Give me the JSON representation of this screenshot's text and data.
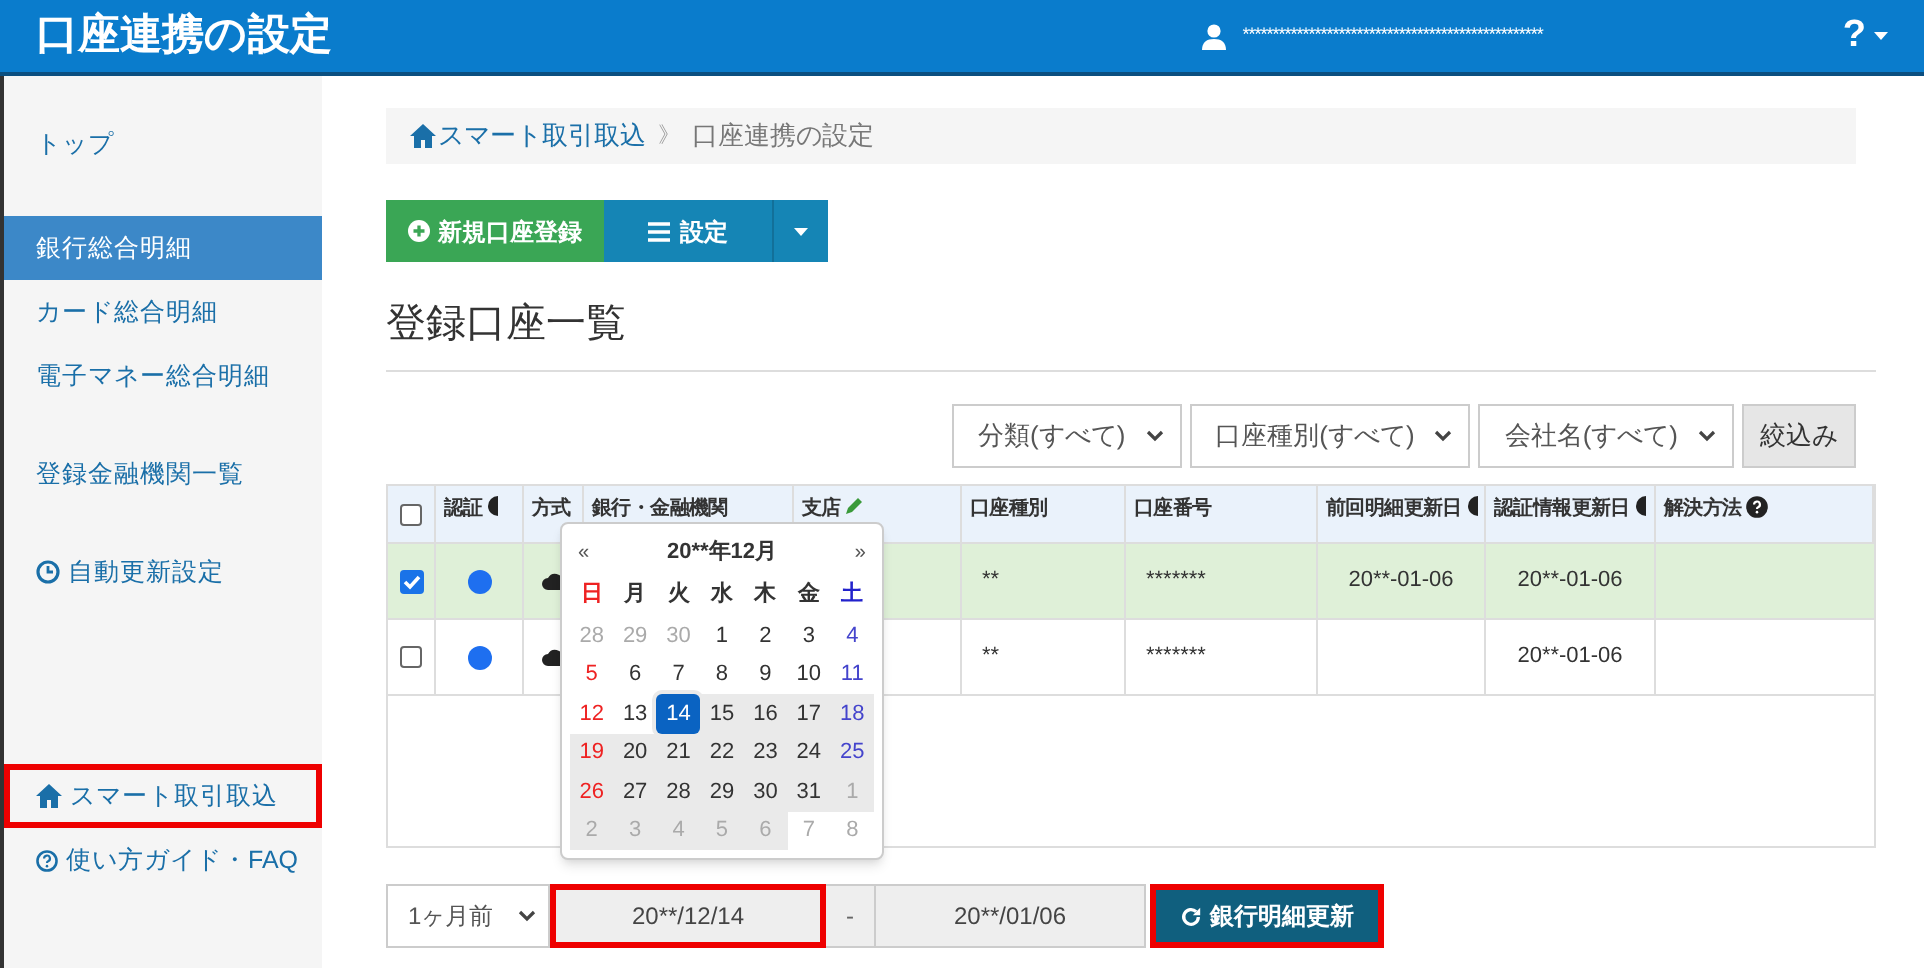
{
  "header": {
    "title": "口座連携の設定",
    "user": "**************************************************",
    "help": "?"
  },
  "sidebar": {
    "groups": [
      [
        {
          "label": "トップ",
          "selected": false,
          "highlighted": false
        }
      ],
      [
        {
          "label": "銀行総合明細",
          "selected": true,
          "highlighted": false
        },
        {
          "label": "カード総合明細",
          "selected": false,
          "highlighted": false
        },
        {
          "label": "電子マネー総合明細",
          "selected": false,
          "highlighted": false
        }
      ],
      [
        {
          "label": "登録金融機関一覧",
          "selected": false,
          "highlighted": false
        }
      ],
      [
        {
          "label": "自動更新設定",
          "kind": "clock",
          "selected": false,
          "highlighted": false
        }
      ],
      [
        {
          "label": "スマート取引取込",
          "kind": "home",
          "selected": false,
          "highlighted": true
        },
        {
          "label": "使い方ガイド・FAQ",
          "kind": "help",
          "selected": false,
          "highlighted": false
        }
      ]
    ]
  },
  "breadcrumb": [
    {
      "label": "スマート取引取込",
      "kind": "link"
    },
    {
      "label": "》",
      "kind": "separator"
    },
    {
      "label": "口座連携の設定",
      "kind": "current"
    }
  ],
  "actions": {
    "new_account": "新規口座登録",
    "settings": "設定"
  },
  "heading": "登録口座一覧",
  "filters": {
    "selects": [
      "分類(すべて)",
      "口座種別(すべて)",
      "会社名(すべて)"
    ],
    "button": "絞込み"
  },
  "table": {
    "select_all": {
      "checked": false
    },
    "columns": [
      {
        "label": "認証"
      },
      {
        "label": "方式"
      },
      {
        "label": "銀行・金融機関"
      },
      {
        "label": "支店"
      },
      {
        "label": "口座種別"
      },
      {
        "label": "口座番号"
      },
      {
        "label": "前回明細更新日"
      },
      {
        "label": "認証情報更新日"
      },
      {
        "label": "解決方法"
      }
    ],
    "rows": [
      {
        "checked": true,
        "account_type": "**",
        "account_number": "*******",
        "last_update": "20**-01-06",
        "auth_update": "20**-01-06"
      },
      {
        "checked": false,
        "account_type": "**",
        "account_number": "*******",
        "last_update": "",
        "auth_update": "20**-01-06"
      }
    ]
  },
  "calendar": {
    "prev": "«",
    "title": "20**年12月",
    "next": "»",
    "weekdays": [
      "日",
      "月",
      "火",
      "水",
      "木",
      "金",
      "土"
    ],
    "weeks": [
      [
        {
          "day": "28",
          "muted": true,
          "in_range": false,
          "selected": false
        },
        {
          "day": "29",
          "muted": true,
          "in_range": false,
          "selected": false
        },
        {
          "day": "30",
          "muted": true,
          "in_range": false,
          "selected": false
        },
        {
          "day": "1",
          "muted": false,
          "in_range": false,
          "selected": false
        },
        {
          "day": "2",
          "muted": false,
          "in_range": false,
          "selected": false
        },
        {
          "day": "3",
          "muted": false,
          "in_range": false,
          "selected": false
        },
        {
          "day": "4",
          "muted": false,
          "in_range": false,
          "selected": false
        }
      ],
      [
        {
          "day": "5",
          "muted": false,
          "in_range": false,
          "selected": false
        },
        {
          "day": "6",
          "muted": false,
          "in_range": false,
          "selected": false
        },
        {
          "day": "7",
          "muted": false,
          "in_range": false,
          "selected": false
        },
        {
          "day": "8",
          "muted": false,
          "in_range": false,
          "selected": false
        },
        {
          "day": "9",
          "muted": false,
          "in_range": false,
          "selected": false
        },
        {
          "day": "10",
          "muted": false,
          "in_range": false,
          "selected": false
        },
        {
          "day": "11",
          "muted": false,
          "in_range": false,
          "selected": false
        }
      ],
      [
        {
          "day": "12",
          "muted": false,
          "in_range": false,
          "selected": false
        },
        {
          "day": "13",
          "muted": false,
          "in_range": false,
          "selected": false
        },
        {
          "day": "14",
          "muted": false,
          "in_range": true,
          "selected": true
        },
        {
          "day": "15",
          "muted": false,
          "in_range": true,
          "selected": false
        },
        {
          "day": "16",
          "muted": false,
          "in_range": true,
          "selected": false
        },
        {
          "day": "17",
          "muted": false,
          "in_range": true,
          "selected": false
        },
        {
          "day": "18",
          "muted": false,
          "in_range": true,
          "selected": false
        }
      ],
      [
        {
          "day": "19",
          "muted": false,
          "in_range": true,
          "selected": false
        },
        {
          "day": "20",
          "muted": false,
          "in_range": true,
          "selected": false
        },
        {
          "day": "21",
          "muted": false,
          "in_range": true,
          "selected": false
        },
        {
          "day": "22",
          "muted": false,
          "in_range": true,
          "selected": false
        },
        {
          "day": "23",
          "muted": false,
          "in_range": true,
          "selected": false
        },
        {
          "day": "24",
          "muted": false,
          "in_range": true,
          "selected": false
        },
        {
          "day": "25",
          "muted": false,
          "in_range": true,
          "selected": false
        }
      ],
      [
        {
          "day": "26",
          "muted": false,
          "in_range": true,
          "selected": false
        },
        {
          "day": "27",
          "muted": false,
          "in_range": true,
          "selected": false
        },
        {
          "day": "28",
          "muted": false,
          "in_range": true,
          "selected": false
        },
        {
          "day": "29",
          "muted": false,
          "in_range": true,
          "selected": false
        },
        {
          "day": "30",
          "muted": false,
          "in_range": true,
          "selected": false
        },
        {
          "day": "31",
          "muted": false,
          "in_range": true,
          "selected": false
        },
        {
          "day": "1",
          "muted": true,
          "in_range": true,
          "selected": false
        }
      ],
      [
        {
          "day": "2",
          "muted": true,
          "in_range": true,
          "selected": false
        },
        {
          "day": "3",
          "muted": true,
          "in_range": true,
          "selected": false
        },
        {
          "day": "4",
          "muted": true,
          "in_range": true,
          "selected": false
        },
        {
          "day": "5",
          "muted": true,
          "in_range": true,
          "selected": false
        },
        {
          "day": "6",
          "muted": true,
          "in_range": true,
          "selected": false
        },
        {
          "day": "7",
          "muted": true,
          "in_range": false,
          "selected": false
        },
        {
          "day": "8",
          "muted": true,
          "in_range": false,
          "selected": false
        }
      ]
    ]
  },
  "period": {
    "range_select": "1ヶ月前",
    "start": {
      "value": "20**/12/14",
      "highlighted": true
    },
    "separator": "-",
    "end": {
      "value": "20**/01/06",
      "highlighted": false
    },
    "update_button": {
      "label": "銀行明細更新",
      "highlighted": true
    }
  }
}
